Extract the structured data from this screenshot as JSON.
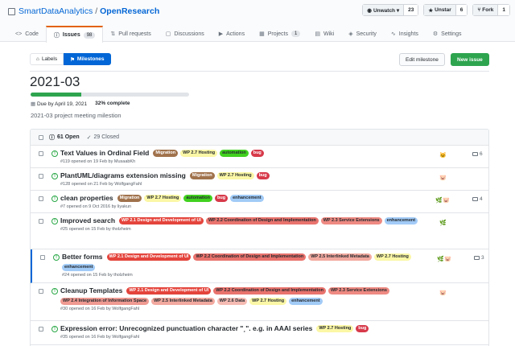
{
  "repo": {
    "owner": "SmartDataAnalytics",
    "separator": "/",
    "name": "OpenResearch"
  },
  "actions": [
    {
      "label": "Unwatch ▾",
      "count": "23",
      "icon": "eye-icon"
    },
    {
      "label": "Unstar",
      "count": "6",
      "icon": "star-icon"
    },
    {
      "label": "Fork",
      "count": "1",
      "icon": "fork-icon"
    }
  ],
  "tabs": [
    {
      "label": "Code",
      "icon": "<>",
      "counter": ""
    },
    {
      "label": "Issues",
      "icon": "ⓘ",
      "counter": "98"
    },
    {
      "label": "Pull requests",
      "icon": "⇅",
      "counter": ""
    },
    {
      "label": "Discussions",
      "icon": "▢",
      "counter": ""
    },
    {
      "label": "Actions",
      "icon": "▶",
      "counter": ""
    },
    {
      "label": "Projects",
      "icon": "▦",
      "counter": "1"
    },
    {
      "label": "Wiki",
      "icon": "▤",
      "counter": ""
    },
    {
      "label": "Security",
      "icon": "◈",
      "counter": ""
    },
    {
      "label": "Insights",
      "icon": "∿",
      "counter": ""
    },
    {
      "label": "Settings",
      "icon": "⚙",
      "counter": ""
    }
  ],
  "subnav": {
    "labels": "Labels",
    "milestones": "Milestones"
  },
  "buttons": {
    "edit": "Edit milestone",
    "new": "New issue"
  },
  "milestone": {
    "title": "2021-03",
    "due": "Due by April 19, 2021",
    "percent": "32% complete",
    "progress_fraction": 0.32,
    "description": "2021-03 project meeting milestion"
  },
  "counts": {
    "open": "61 Open",
    "closed": "29 Closed"
  },
  "label_colors": {
    "Migration": [
      "#a0724c",
      "#ffffff"
    ],
    "WP 2.7 Hosting": [
      "#fbf7a6",
      "#24292e"
    ],
    "automation": [
      "#41d11f",
      "#24292e"
    ],
    "bug": [
      "#d73a4a",
      "#ffffff"
    ],
    "enhancement": [
      "#a2cbf7",
      "#24292e"
    ],
    "WP 2.1 Design and Development of UI": [
      "#e4443c",
      "#ffffff"
    ],
    "WP 2.2 Coordination of Design and Implementation": [
      "#e9736d",
      "#24292e"
    ],
    "WP 2.3 Service Extensions": [
      "#ee8a82",
      "#24292e"
    ],
    "WP 2.4 Integration of Information Space": [
      "#ef9a92",
      "#24292e"
    ],
    "WP 2.5 Interlinked Metadata": [
      "#f2a99f",
      "#24292e"
    ],
    "WP 2.6 Data": [
      "#f5bbb3",
      "#24292e"
    ]
  },
  "issues": [
    {
      "title": "Text Values in Ordinal Field",
      "labels": [
        "Migration",
        "WP 2.7 Hosting",
        "automation",
        "bug"
      ],
      "meta": "#119 opened on 19 Feb by MusaabKh",
      "comments": "6",
      "avatars": [
        "🐱"
      ]
    },
    {
      "title": "PlantUML/diagrams extension missing",
      "labels": [
        "Migration",
        "WP 2.7 Hosting",
        "bug"
      ],
      "meta": "#128 opened on 21 Feb by WolfgangFahl",
      "comments": "",
      "avatars": [
        "🐷"
      ]
    },
    {
      "title": "clean properties",
      "labels": [
        "Migration",
        "WP 2.7 Hosting",
        "automation",
        "bug",
        "enhancement"
      ],
      "meta": "#7 opened on 9 Oct 2016 by liyakun",
      "comments": "4",
      "avatars": [
        "🌿",
        "🐷"
      ]
    },
    {
      "title": "Improved search",
      "labels": [
        "WP 2.1 Design and Development of UI",
        "WP 2.2 Coordination of Design and Implementation",
        "WP 2.3 Service Extensions",
        "enhancement"
      ],
      "meta": "#25 opened on 15 Feb by tholzheim",
      "comments": "",
      "avatars": [
        "🌿"
      ]
    },
    {
      "title": "Better forms",
      "labels": [
        "WP 2.1 Design and Development of UI",
        "WP 2.2 Coordination of Design and Implementation",
        "WP 2.5 Interlinked Metadata",
        "WP 2.7 Hosting",
        "enhancement"
      ],
      "meta": "#24 opened on 15 Feb by tholzheim",
      "comments": "3",
      "avatars": [
        "🌿",
        "🐷"
      ]
    },
    {
      "title": "Cleanup Templates",
      "labels": [
        "WP 2.1 Design and Development of UI",
        "WP 2.2 Coordination of Design and Implementation",
        "WP 2.3 Service Extensions",
        "WP 2.4 Integration of Information Space",
        "WP 2.5 Interlinked Metadata",
        "WP 2.6 Data",
        "WP 2.7 Hosting",
        "enhancement"
      ],
      "meta": "#30 opened on 16 Feb by WolfgangFahl",
      "comments": "",
      "avatars": [
        "🐷"
      ]
    },
    {
      "title": "Expression error: Unrecognized punctuation character \"¸\". e.g. in AAAI series",
      "labels": [
        "WP 2.7 Hosting",
        "bug"
      ],
      "meta": "#35 opened on 16 Feb by WolfgangFahl",
      "comments": "",
      "avatars": []
    }
  ]
}
